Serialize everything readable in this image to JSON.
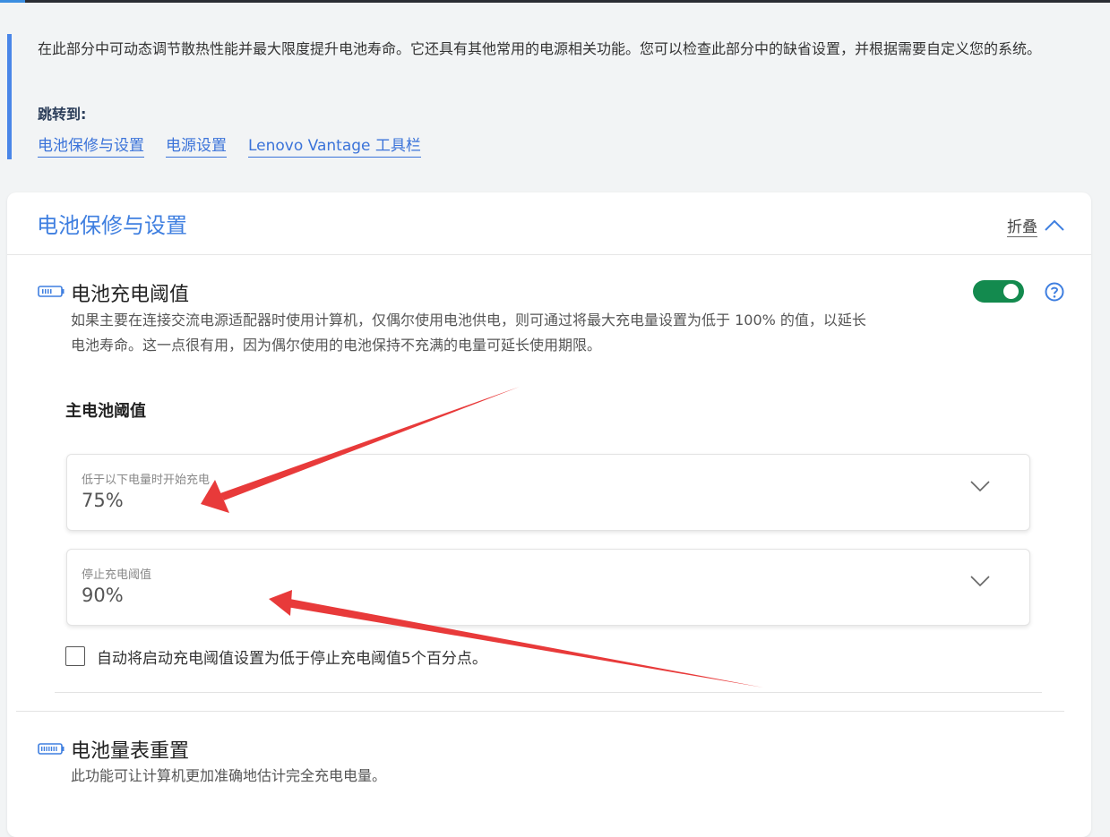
{
  "intro": {
    "text": "在此部分中可动态调节散热性能并最大限度提升电池寿命。它还具有其他常用的电源相关功能。您可以检查此部分中的缺省设置，并根据需要自定义您的系统。",
    "jump_label": "跳转到:",
    "links": [
      "电池保修与设置",
      "电源设置",
      "Lenovo Vantage 工具栏"
    ]
  },
  "card": {
    "title": "电池保修与设置",
    "collapse_label": "折叠"
  },
  "threshold": {
    "title": "电池充电阈值",
    "description": "如果主要在连接交流电源适配器时使用计算机，仅偶尔使用电池供电，则可通过将最大充电量设置为低于 100% 的值，以延长电池寿命。这一点很有用，因为偶尔使用的电池保持不充满的电量可延长使用期限。",
    "toggle_on": true,
    "subtitle": "主电池阈值",
    "start_label": "低于以下电量时开始充电",
    "start_value": "75%",
    "stop_label": "停止充电阈值",
    "stop_value": "90%",
    "auto_checkbox_label": "自动将启动充电阈值设置为低于停止充电阈值5个百分点。",
    "auto_checked": false
  },
  "gauge_reset": {
    "title": "电池量表重置",
    "description": "此功能可让计算机更加准确地估计完全充电电量。"
  },
  "colors": {
    "accent": "#3f7fe0",
    "toggle_on": "#138a4e",
    "annotation_arrow": "#e83a3a"
  }
}
